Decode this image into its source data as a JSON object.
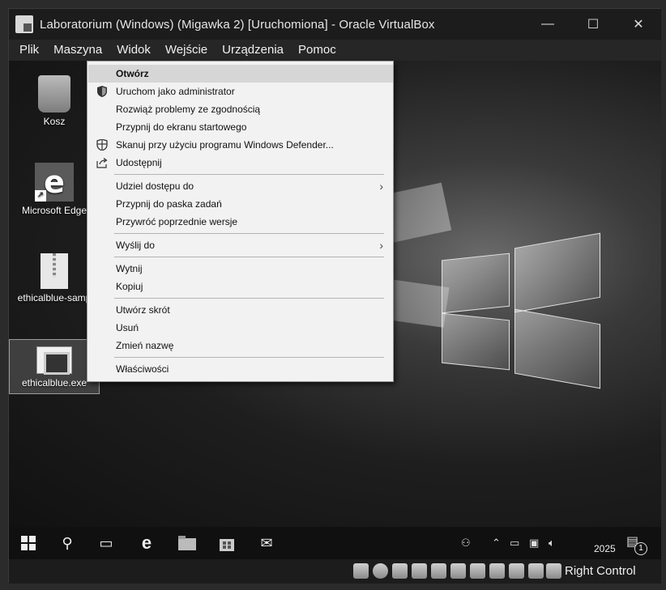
{
  "window": {
    "title": "Laboratorium (Windows) (Migawka 2) [Uruchomiona] - Oracle VirtualBox",
    "controls": {
      "minimize": "—",
      "maximize": "☐",
      "close": "✕"
    }
  },
  "menubar": [
    "Plik",
    "Maszyna",
    "Widok",
    "Wejście",
    "Urządzenia",
    "Pomoc"
  ],
  "desktop_icons": [
    {
      "label": "Kosz",
      "icon": "recycle-bin-icon"
    },
    {
      "label": "Microsoft Edge",
      "icon": "edge-icon"
    },
    {
      "label": "ethicalblue-samp",
      "icon": "zip-folder-icon"
    },
    {
      "label": "ethicalblue.exe",
      "icon": "exe-file-icon"
    }
  ],
  "context_menu": {
    "items": [
      {
        "label": "Otwórz",
        "highlight": true
      },
      {
        "label": "Uruchom jako administrator",
        "icon": "shield-icon"
      },
      {
        "label": "Rozwiąż problemy ze zgodnością"
      },
      {
        "label": "Przypnij do ekranu startowego"
      },
      {
        "label": "Skanuj przy użyciu programu Windows Defender...",
        "icon": "defender-icon"
      },
      {
        "label": "Udostępnij",
        "icon": "share-icon"
      },
      {
        "label": "Udziel dostępu do",
        "submenu": true
      },
      {
        "label": "Przypnij do paska zadań"
      },
      {
        "label": "Przywróć poprzednie wersje"
      },
      {
        "label": "Wyślij do",
        "submenu": true
      },
      {
        "label": "Wytnij"
      },
      {
        "label": "Kopiuj"
      },
      {
        "label": "Utwórz skrót"
      },
      {
        "label": "Usuń"
      },
      {
        "label": "Zmień nazwę"
      },
      {
        "label": "Właściwości"
      }
    ]
  },
  "taskbar": {
    "icons": [
      "windows-start-icon",
      "search-icon",
      "task-view-icon",
      "edge-icon",
      "file-explorer-icon",
      "store-icon",
      "mail-icon"
    ],
    "tray": {
      "clock_text": "2025",
      "notification_count": "1"
    }
  },
  "statusbar": {
    "host_key_label": "Right Control"
  }
}
